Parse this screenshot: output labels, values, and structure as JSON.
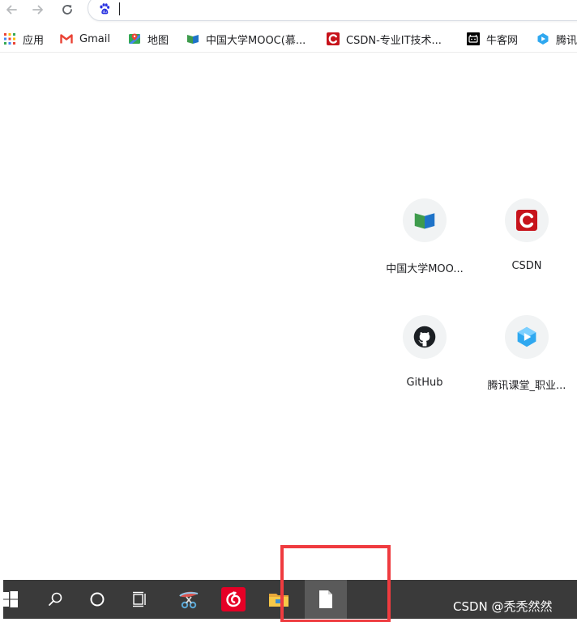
{
  "browser": {
    "toolbar": {
      "back_icon": "arrow-left-icon",
      "forward_icon": "arrow-right-icon",
      "reload_icon": "reload-icon",
      "omnibox_value": "",
      "omnibox_engine_icon": "baidu-paw-icon"
    },
    "bookmarks": [
      {
        "label": "应用",
        "icon": "apps-grid-icon"
      },
      {
        "label": "Gmail",
        "icon": "gmail-icon"
      },
      {
        "label": "地图",
        "icon": "maps-icon"
      },
      {
        "label": "中国大学MOOC(慕...",
        "icon": "mooc-icon"
      },
      {
        "label": "CSDN-专业IT技术...",
        "icon": "csdn-icon"
      },
      {
        "label": "牛客网",
        "icon": "nowcoder-icon"
      },
      {
        "label": "腾讯",
        "icon": "tencent-classroom-icon"
      }
    ],
    "shortcuts": [
      {
        "label": "中国大学MOO...",
        "icon": "mooc-icon"
      },
      {
        "label": "CSDN",
        "icon": "csdn-icon"
      },
      {
        "label": "GitHub",
        "icon": "github-icon"
      },
      {
        "label": "腾讯课堂_职业...",
        "icon": "tencent-classroom-icon"
      }
    ]
  },
  "taskbar": {
    "items": [
      {
        "name": "start",
        "icon": "windows-icon"
      },
      {
        "name": "search",
        "icon": "search-icon"
      },
      {
        "name": "cortana",
        "icon": "circle-icon"
      },
      {
        "name": "task-view",
        "icon": "task-view-icon"
      },
      {
        "name": "snipping-tool",
        "icon": "scissors-icon"
      },
      {
        "name": "netease-music",
        "icon": "netease-music-icon"
      },
      {
        "name": "file-explorer",
        "icon": "folder-icon"
      },
      {
        "name": "blank-document",
        "icon": "document-icon"
      }
    ]
  },
  "watermark": "CSDN @秃秃然然",
  "colors": {
    "taskbar_bg": "#3a3a3a",
    "highlight": "#ef3b3f",
    "csdn_red": "#c7131b",
    "mooc_green": "#3e9b4c",
    "mooc_blue": "#1e73c8",
    "tile_bg": "#f1f3f4"
  }
}
